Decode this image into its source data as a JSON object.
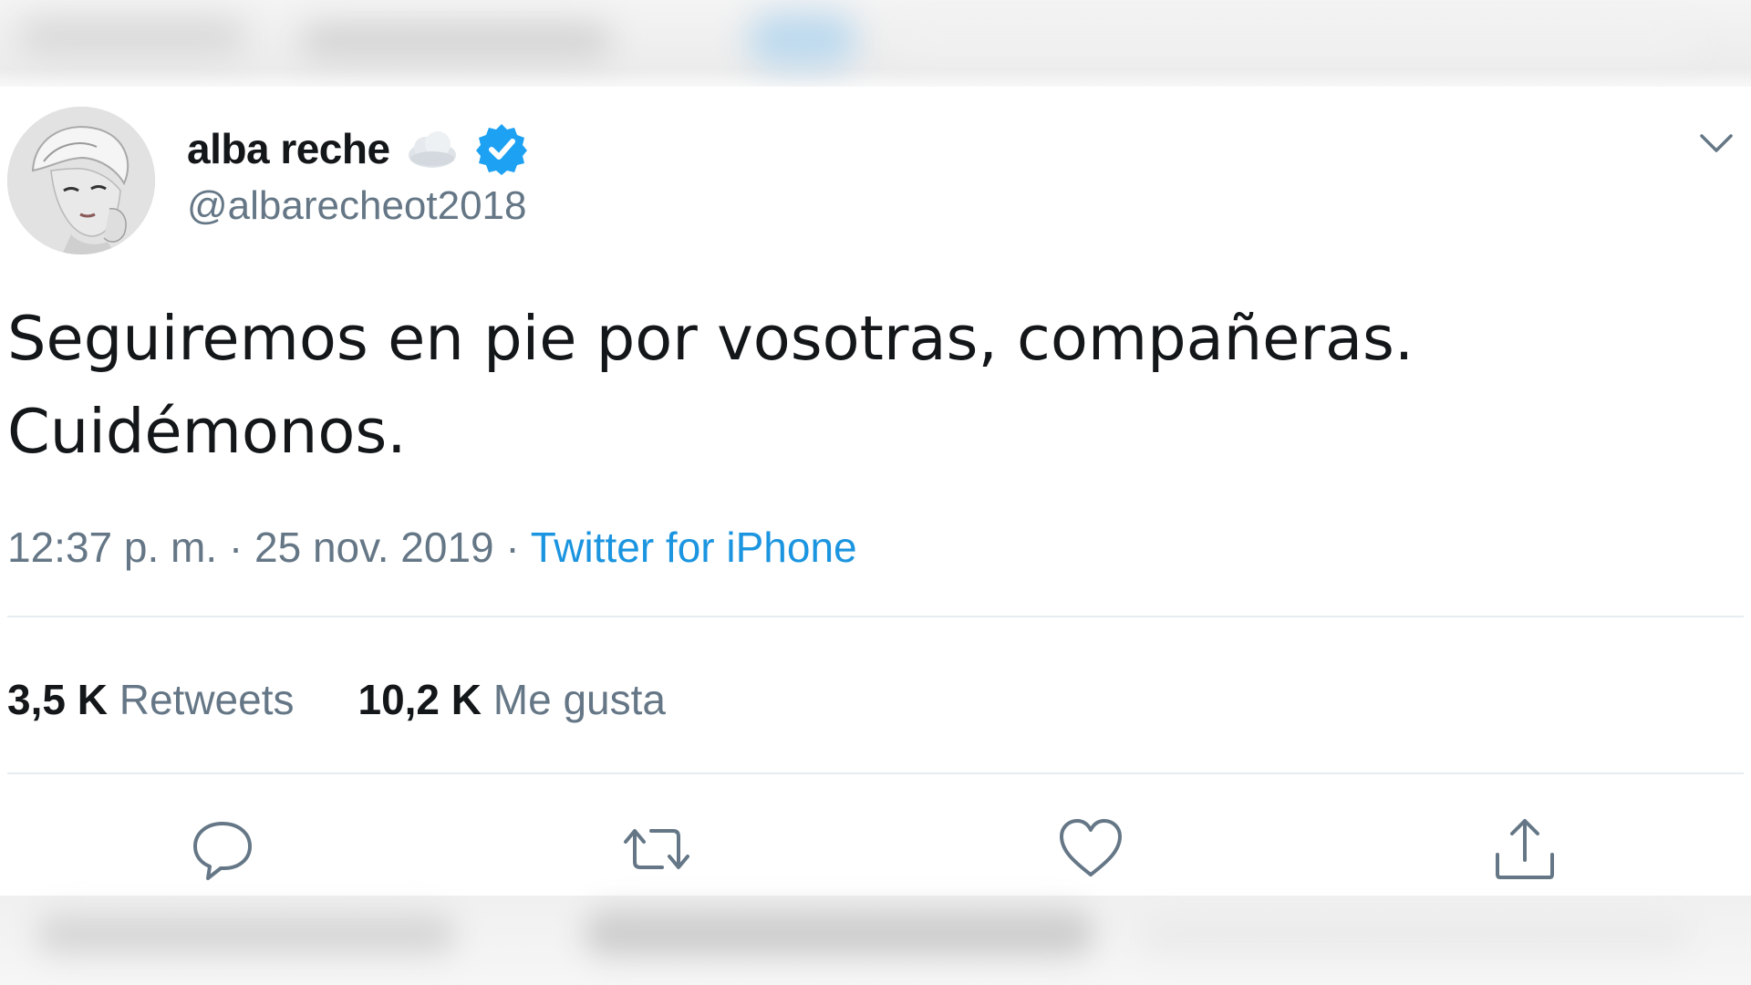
{
  "tweet": {
    "author": {
      "display_name": "alba reche",
      "handle": "@albarecheot2018",
      "name_emoji_icon": "cloud-icon",
      "verified_icon": "verified-badge-icon"
    },
    "text": "Seguiremos en pie por vosotras, compañeras.\nCuidémonos.",
    "meta": {
      "time": "12:37 p. m.",
      "separator": " · ",
      "date": "25 nov. 2019",
      "separator2": " · ",
      "source": "Twitter for iPhone"
    },
    "stats": {
      "retweets_count": "3,5 K",
      "retweets_label": "Retweets",
      "likes_count": "10,2 K",
      "likes_label": "Me gusta"
    },
    "actions": [
      "reply-icon",
      "retweet-icon",
      "like-icon",
      "share-icon"
    ],
    "colors": {
      "text": "#14171a",
      "secondary": "#657786",
      "link": "#1b95e0",
      "verified": "#1da1f2",
      "divider": "#e6ecf0"
    }
  }
}
